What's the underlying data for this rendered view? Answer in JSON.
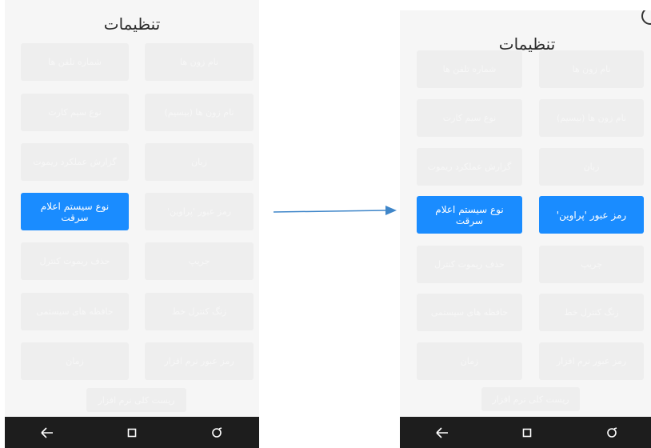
{
  "left": {
    "title": "تنظیمات",
    "buttons": [
      {
        "label": "نام زون ها",
        "state": "faded"
      },
      {
        "label": "شماره تلفن ها",
        "state": "faded"
      },
      {
        "label": "نام زون ها (بیسیم)",
        "state": "faded"
      },
      {
        "label": "نوع سیم کارت",
        "state": "faded"
      },
      {
        "label": "زبان",
        "state": "faded"
      },
      {
        "label": "گزارش عملکرد ریموت",
        "state": "faded"
      },
      {
        "label": "رمز عبور 'پراوین'",
        "state": "faded"
      },
      {
        "label": "نوع سیستم اعلام سرقت",
        "state": "active"
      },
      {
        "label": "جریپ",
        "state": "faded"
      },
      {
        "label": "حذف ریموت کنترل",
        "state": "faded"
      },
      {
        "label": "زنگ کنترل خط",
        "state": "faded"
      },
      {
        "label": "حافظه های سیستمی",
        "state": "faded"
      },
      {
        "label": "رمز عبور نرم افزار",
        "state": "faded"
      },
      {
        "label": "زمان",
        "state": "faded"
      },
      {
        "label": "ریست کلی نرم افزار",
        "state": "faded"
      }
    ]
  },
  "right": {
    "title": "تنظیمات",
    "buttons": [
      {
        "label": "نام زون ها",
        "state": "faded"
      },
      {
        "label": "شماره تلفن ها",
        "state": "faded"
      },
      {
        "label": "نام زون ها (بیسیم)",
        "state": "faded"
      },
      {
        "label": "نوع سیم کارت",
        "state": "faded"
      },
      {
        "label": "زبان",
        "state": "faded"
      },
      {
        "label": "گزارش عملکرد ریموت",
        "state": "faded"
      },
      {
        "label": "رمز عبور 'پراوین'",
        "state": "active"
      },
      {
        "label": "نوع سیستم اعلام سرقت",
        "state": "active"
      },
      {
        "label": "جریپ",
        "state": "faded"
      },
      {
        "label": "حذف ریموت کنترل",
        "state": "faded"
      },
      {
        "label": "زنگ کنترل خط",
        "state": "faded"
      },
      {
        "label": "حافظه های سیستمی",
        "state": "faded"
      },
      {
        "label": "رمز عبور نرم افزار",
        "state": "faded"
      },
      {
        "label": "زمان",
        "state": "faded"
      },
      {
        "label": "ریست کلی نرم افزار",
        "state": "faded"
      }
    ]
  },
  "navbar": {
    "icons": [
      "back-icon",
      "home-icon",
      "recents-icon"
    ]
  },
  "colors": {
    "accent": "#1a8cff",
    "navbar": "#1d1d1d",
    "screen_bg": "#f6f6f6",
    "arrow": "#3f86c9"
  }
}
